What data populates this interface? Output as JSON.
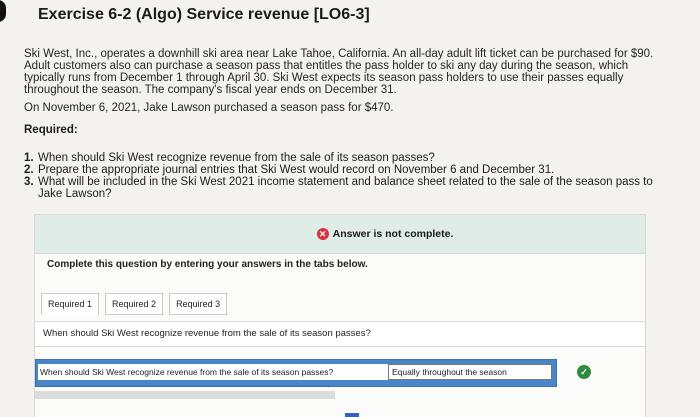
{
  "title": "Exercise 6-2 (Algo) Service revenue [LO6-3]",
  "paragraph1": "Ski West, Inc., operates a downhill ski area near Lake Tahoe, California. An all-day adult lift ticket can be purchased for $90. Adult customers also can purchase a season pass that entitles the pass holder to ski any day during the season, which typically runs from December 1 through April 30. Ski West expects its season pass holders to use their passes equally throughout the season. The company's fiscal year ends on December 31.",
  "paragraph2": "On November 6, 2021, Jake Lawson purchased a season pass for $470.",
  "required_heading": "Required:",
  "requirements": [
    {
      "num": "1.",
      "text": "When should Ski West recognize revenue from the sale of its season passes?"
    },
    {
      "num": "2.",
      "text": "Prepare the appropriate journal entries that Ski West would record on November 6 and December 31."
    },
    {
      "num": "3.",
      "text": "What will be included in the Ski West 2021 income statement and balance sheet related to the sale of the season pass to Jake Lawson?"
    }
  ],
  "alert": {
    "icon": "x-circle-icon",
    "text": "Answer is not complete.",
    "color": "#d9333f"
  },
  "instruction": "Complete this question by entering your answers in the tabs below.",
  "tabs": [
    "Required 1",
    "Required 2",
    "Required 3"
  ],
  "question": "When should Ski West recognize revenue from the sale of its season passes?",
  "answer_row": {
    "question": "When should Ski West recognize revenue from the sale of its season passes?",
    "value": "Equally throughout the season",
    "status_icon": "check-circle-icon",
    "status_color": "#2e8a3d"
  }
}
